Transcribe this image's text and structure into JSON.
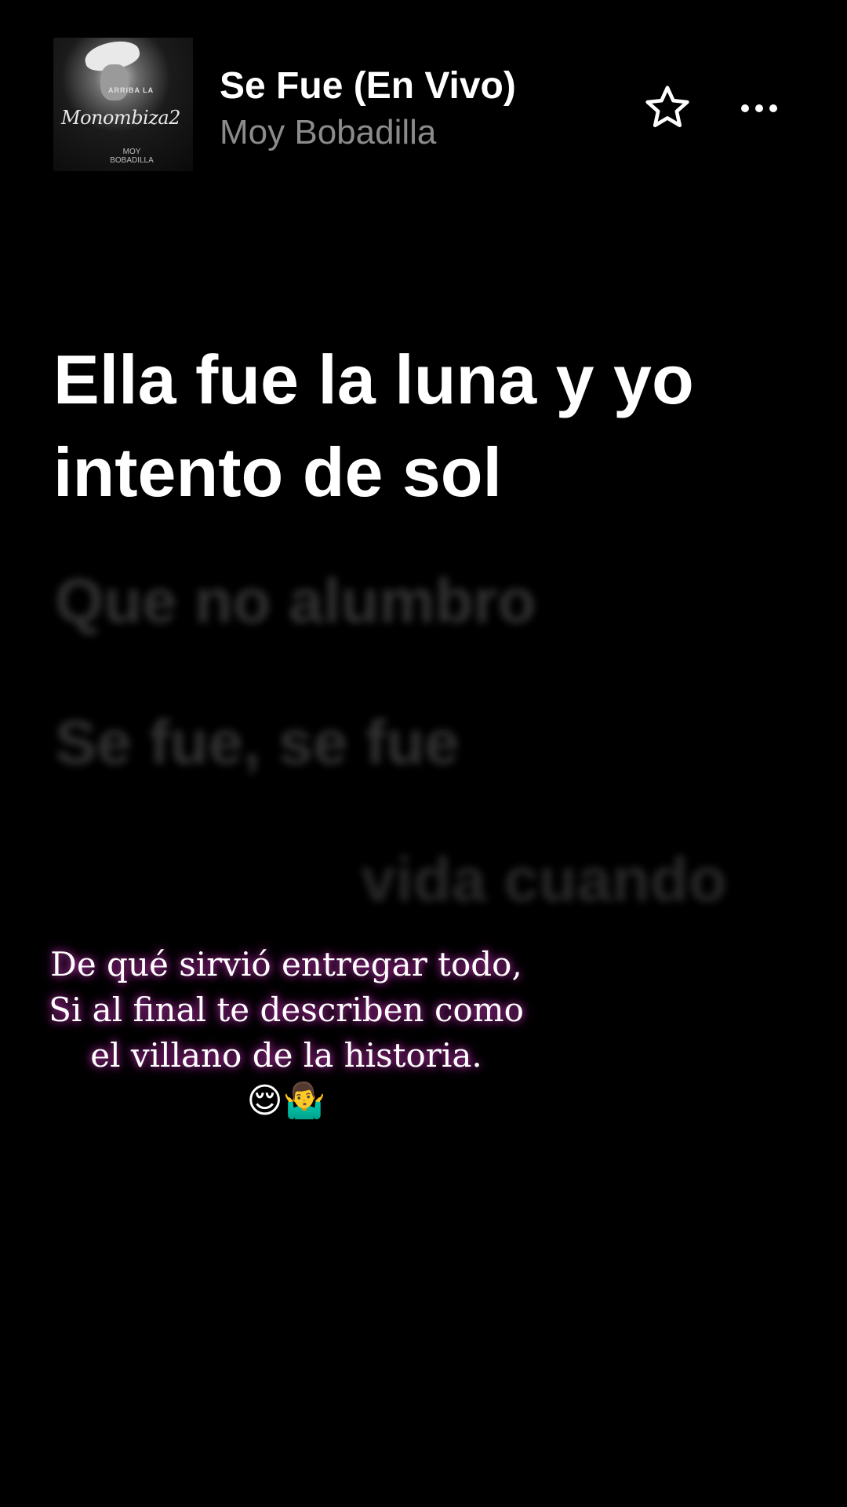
{
  "header": {
    "song_title": "Se Fue (En Vivo)",
    "artist": "Moy Bobadilla",
    "album_art_text": "Monombiza2",
    "album_art_small_text": "ARRIBA LA",
    "album_art_bottom_text": "MOY BOBADILLA",
    "favorite_icon": "star-icon",
    "more_icon": "ellipsis-icon"
  },
  "lyrics": {
    "active": "Ella fue la luna y yo intento de sol",
    "upcoming_1": "Que no alumbro",
    "upcoming_2": "Se fue, se fue",
    "upcoming_3": "vida cuando"
  },
  "caption": {
    "line1": "De qué sirvió entregar todo,",
    "line2": "Si al final te describen como",
    "line3": "el villano de la historia.",
    "emojis": "😌🤷‍♂️"
  },
  "colors": {
    "background": "#000000",
    "title": "#ffffff",
    "artist": "#8b8b8b",
    "glow": "#dc3cc8"
  }
}
